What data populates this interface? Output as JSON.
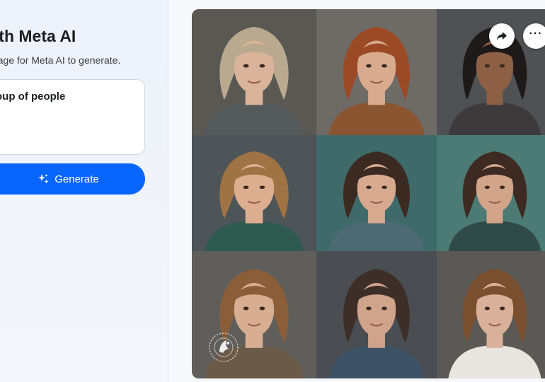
{
  "left_panel": {
    "title": "with Meta AI",
    "subtitle": "image for Meta AI to generate.",
    "prompt_value": "oup of people",
    "generate_label": "Generate"
  },
  "image_card": {
    "cells": [
      {
        "bg": "#5a5853",
        "hair": "#b9a98f",
        "skin": "#d9b49a",
        "shirt": "#555a5a"
      },
      {
        "bg": "#6e6b67",
        "hair": "#9b4a25",
        "skin": "#d8ab8e",
        "shirt": "#8a5530"
      },
      {
        "bg": "#505154",
        "hair": "#1e1a1a",
        "skin": "#8d5f44",
        "shirt": "#3d3a3c"
      },
      {
        "bg": "#4e5558",
        "hair": "#a07344",
        "skin": "#dcae8f",
        "shirt": "#2f5a50"
      },
      {
        "bg": "#3f6a6a",
        "hair": "#3b2a22",
        "skin": "#d7aa90",
        "shirt": "#4d6a74"
      },
      {
        "bg": "#4c7a75",
        "hair": "#3d2a22",
        "skin": "#d2a48a",
        "shirt": "#2f4a48"
      },
      {
        "bg": "#5f5e5a",
        "hair": "#8b5e3a",
        "skin": "#d8ae92",
        "shirt": "#6a5a48"
      },
      {
        "bg": "#4a4d52",
        "hair": "#3d2f28",
        "skin": "#d0a48a",
        "shirt": "#3e5266"
      },
      {
        "bg": "#5b5955",
        "hair": "#7a4f30",
        "skin": "#d9b099",
        "shirt": "#e8e4e0"
      }
    ]
  },
  "icons": {
    "share": "share-arrow-icon",
    "more": "more-horizontal-icon",
    "sparkle": "sparkle-icon",
    "watermark": "meta-ai-watermark-icon"
  },
  "colors": {
    "accent": "#0866ff"
  }
}
